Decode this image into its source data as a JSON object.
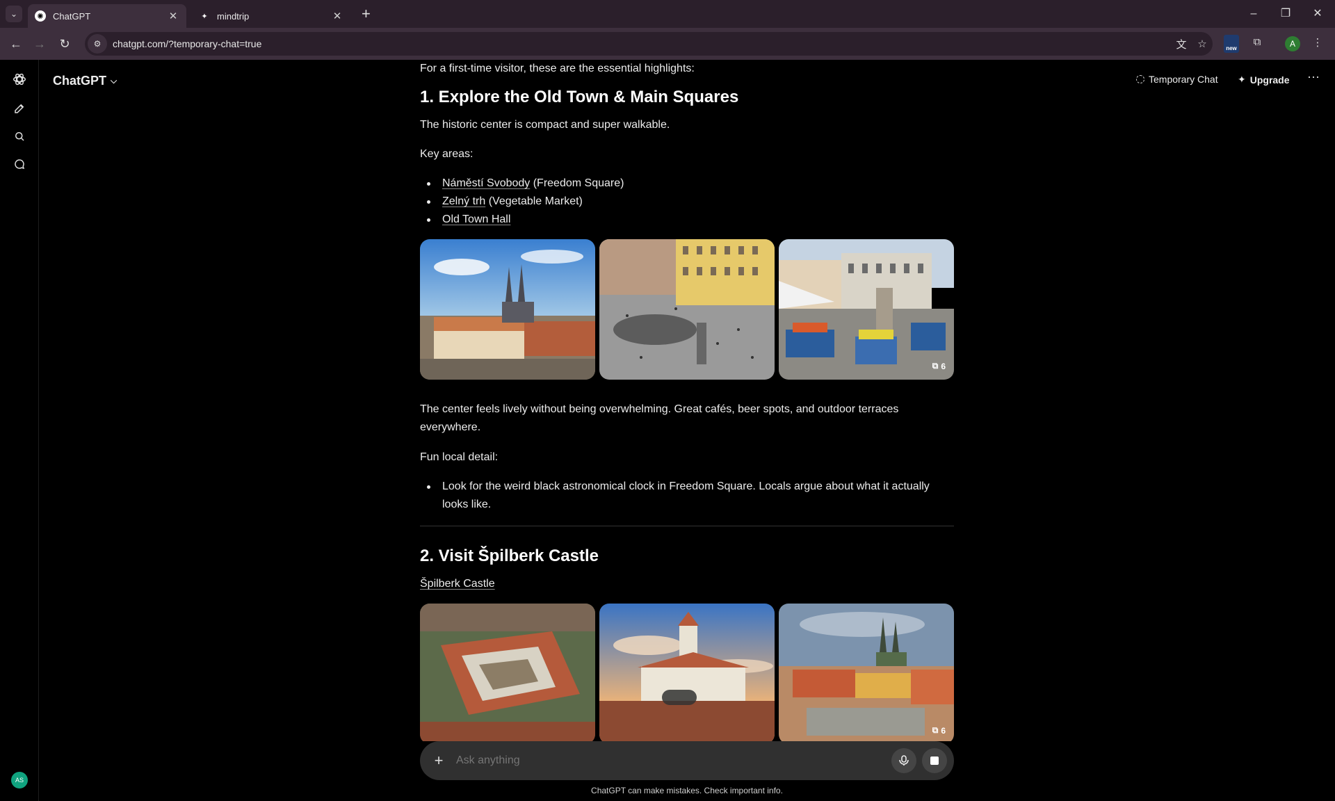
{
  "browser": {
    "tabs": [
      {
        "title": "ChatGPT",
        "active": true
      },
      {
        "title": "mindtrip",
        "active": false
      }
    ],
    "url": "chatgpt.com/?temporary-chat=true",
    "profile_initial": "A",
    "extension_badge": "new"
  },
  "app": {
    "model_label": "ChatGPT",
    "temporary_chat_label": "Temporary Chat",
    "upgrade_label": "Upgrade",
    "user_initials": "AS"
  },
  "message": {
    "intro": "For a first-time visitor, these are the essential highlights:",
    "section1": {
      "heading": "1. Explore the Old Town & Main Squares",
      "para1": "The historic center is compact and super walkable.",
      "key_areas_label": "Key areas:",
      "areas": [
        {
          "link": "Náměstí Svobody",
          "suffix": " (Freedom Square)"
        },
        {
          "link": "Zelný trh",
          "suffix": " (Vegetable Market)"
        },
        {
          "link": "Old Town Hall",
          "suffix": ""
        }
      ],
      "image_count": "6",
      "para2": "The center feels lively without being overwhelming. Great cafés, beer spots, and outdoor terraces everywhere.",
      "fun_label": "Fun local detail:",
      "fun_items": [
        "Look for the weird black astronomical clock in Freedom Square. Locals argue about what it actually looks like."
      ]
    },
    "section2": {
      "heading": "2. Visit Špilberk Castle",
      "link": "Špilberk Castle",
      "image_count": "6"
    }
  },
  "composer": {
    "placeholder": "Ask anything"
  },
  "disclaimer": "ChatGPT can make mistakes. Check important info."
}
